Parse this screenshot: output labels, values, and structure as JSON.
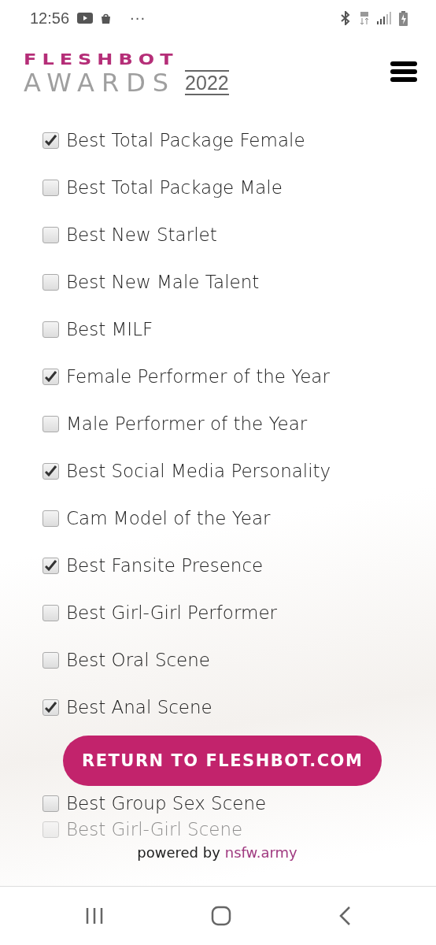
{
  "status_bar": {
    "time": "12:56",
    "more": "···"
  },
  "logo": {
    "line_1": "FLESHBOT",
    "line_2": "AWARDS",
    "year": "2022"
  },
  "categories": [
    {
      "label": "Best Total Package Female",
      "checked": true
    },
    {
      "label": "Best Total Package Male",
      "checked": false
    },
    {
      "label": "Best New Starlet",
      "checked": false
    },
    {
      "label": "Best New Male Talent",
      "checked": false
    },
    {
      "label": "Best MILF",
      "checked": false
    },
    {
      "label": "Female Performer of the Year",
      "checked": true
    },
    {
      "label": "Male Performer of the Year",
      "checked": false
    },
    {
      "label": "Best Social Media Personality",
      "checked": true
    },
    {
      "label": "Cam Model of the Year",
      "checked": false
    },
    {
      "label": "Best Fansite Presence",
      "checked": true
    },
    {
      "label": "Best Girl-Girl Performer",
      "checked": false
    },
    {
      "label": "Best Oral Scene",
      "checked": false
    },
    {
      "label": "Best Anal Scene",
      "checked": true
    },
    {
      "label": "Best Group Sex Scene",
      "checked": false
    },
    {
      "label": "Best Girl-Girl Scene",
      "checked": false
    }
  ],
  "return_button": "RETURN TO FLESHBOT.COM",
  "footer": {
    "text": "powered by",
    "link": "nsfw.army"
  }
}
